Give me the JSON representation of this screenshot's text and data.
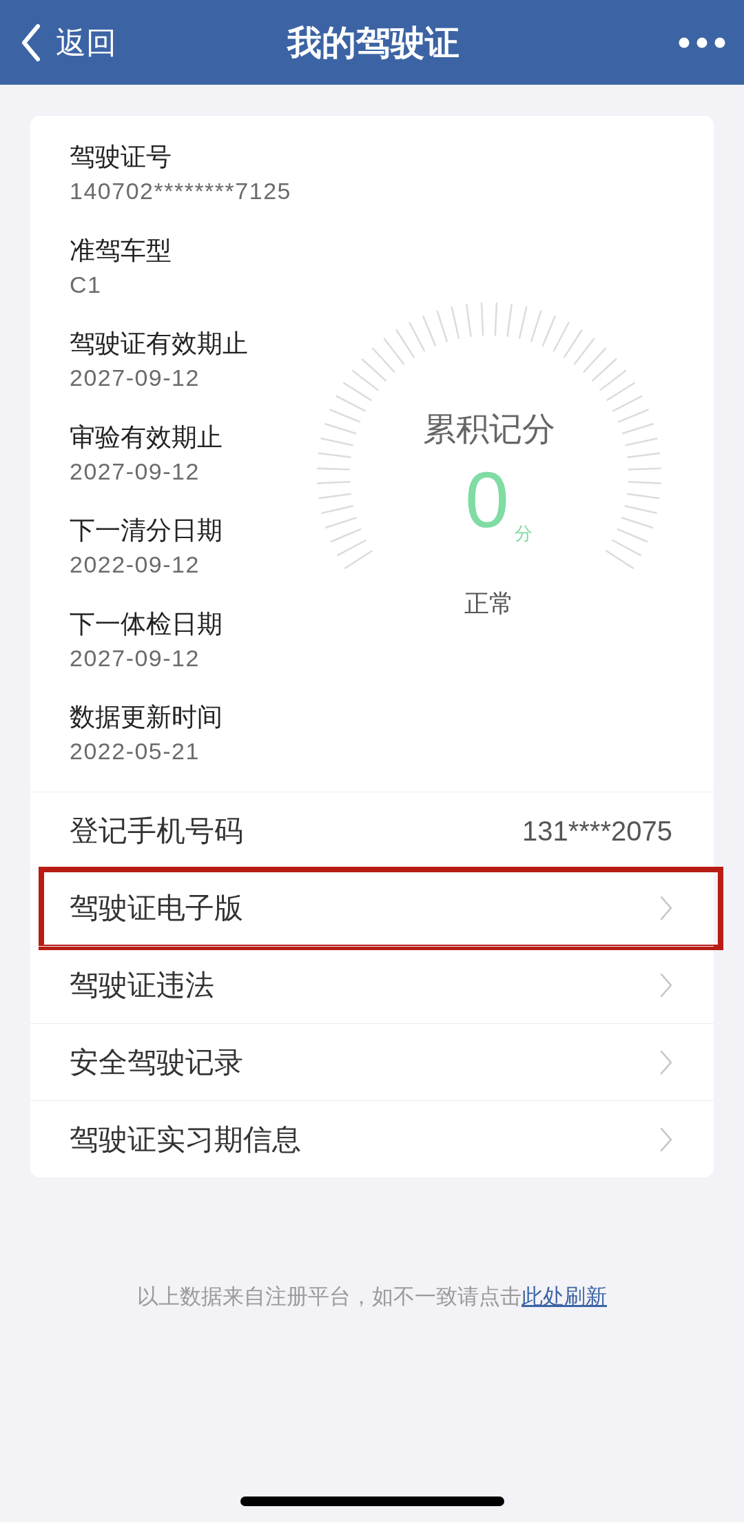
{
  "nav_bar": {
    "back_label": "返回",
    "title": "我的驾驶证"
  },
  "license_fields": [
    {
      "label": "驾驶证号",
      "value": "140702********7125"
    },
    {
      "label": "准驾车型",
      "value": "C1"
    },
    {
      "label": "驾驶证有效期止",
      "value": "2027-09-12"
    },
    {
      "label": "审验有效期止",
      "value": "2027-09-12"
    },
    {
      "label": "下一清分日期",
      "value": "2022-09-12"
    },
    {
      "label": "下一体检日期",
      "value": "2027-09-12"
    },
    {
      "label": "数据更新时间",
      "value": "2022-05-21"
    }
  ],
  "points_gauge": {
    "title": "累积记分",
    "score": "0",
    "unit": "分",
    "status": "正常"
  },
  "rows": [
    {
      "kind": "value",
      "label": "登记手机号码",
      "value": "131****2075",
      "highlighted": false
    },
    {
      "kind": "link",
      "label": "驾驶证电子版",
      "highlighted": true
    },
    {
      "kind": "link",
      "label": "驾驶证违法",
      "highlighted": false
    },
    {
      "kind": "link",
      "label": "安全驾驶记录",
      "highlighted": false
    },
    {
      "kind": "link",
      "label": "驾驶证实习期信息",
      "highlighted": false
    }
  ],
  "footer": {
    "text": "以上数据来自注册平台，如不一致请点击",
    "link": "此处刷新"
  }
}
